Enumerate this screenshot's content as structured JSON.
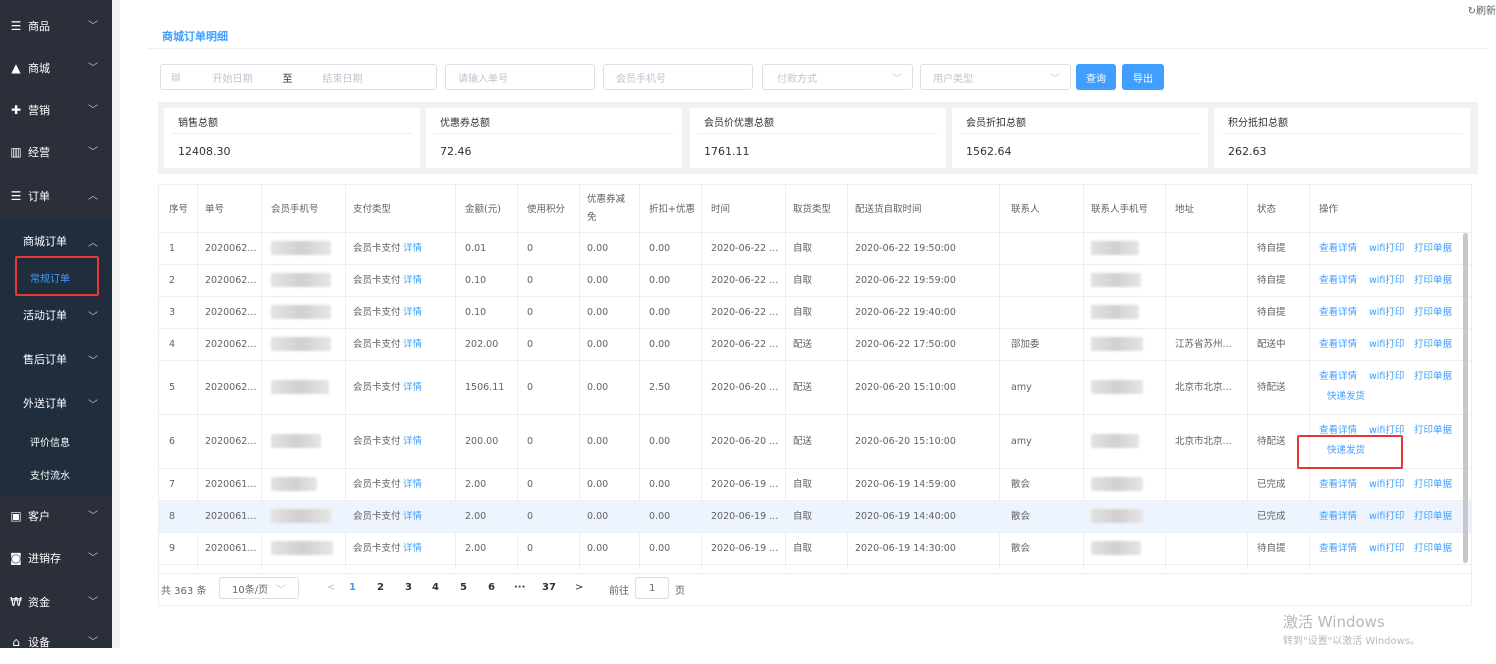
{
  "sidebar": {
    "items": [
      {
        "icon": "list-icon",
        "glyph": "☰",
        "label": "商品"
      },
      {
        "icon": "store-icon",
        "glyph": "▲",
        "label": "商城"
      },
      {
        "icon": "gift-icon",
        "glyph": "✚",
        "label": "营销"
      },
      {
        "icon": "chart-icon",
        "glyph": "▥",
        "label": "经营"
      },
      {
        "icon": "order-icon",
        "glyph": "☰",
        "label": "订单"
      },
      {
        "icon": "customer-icon",
        "glyph": "▣",
        "label": "客户"
      },
      {
        "icon": "truck-icon",
        "glyph": "◙",
        "label": "进销存"
      },
      {
        "icon": "money-icon",
        "glyph": "₩",
        "label": "资金"
      },
      {
        "icon": "device-icon",
        "glyph": "⌂",
        "label": "设备"
      }
    ],
    "sub": {
      "mall_order": "商城订单",
      "normal_order": "常规订单",
      "activity_order": "活动订单",
      "aftersale_order": "售后订单",
      "delivery_order": "外送订单",
      "review": "评价信息",
      "payment_flow": "支付流水"
    }
  },
  "header": {
    "title": "商城订单明细",
    "refresh": "刷新"
  },
  "filters": {
    "start_date": "开始日期",
    "to": "至",
    "end_date": "结束日期",
    "order_no_placeholder": "请输入单号",
    "phone_placeholder": "会员手机号",
    "pay_method_placeholder": "付款方式",
    "user_type_placeholder": "用户类型",
    "query": "查询",
    "export": "导出"
  },
  "summary": [
    {
      "label": "销售总额",
      "value": "12408.30"
    },
    {
      "label": "优惠券总额",
      "value": "72.46"
    },
    {
      "label": "会员价优惠总额",
      "value": "1761.11"
    },
    {
      "label": "会员折扣总额",
      "value": "1562.64"
    },
    {
      "label": "积分抵扣总额",
      "value": "262.63"
    }
  ],
  "table": {
    "headers": [
      "序号",
      "单号",
      "会员手机号",
      "支付类型",
      "金额(元)",
      "使用积分",
      "优惠券减",
      "免",
      "折扣+优惠",
      "时间",
      "取货类型",
      "配送货自取时间",
      "联系人",
      "联系人手机号",
      "地址",
      "状态",
      "操作"
    ],
    "action_labels": {
      "detail": "查看详情",
      "wifi": "wifi打印",
      "print": "打印单据",
      "express": "快递发货"
    },
    "rows": [
      {
        "seq": "1",
        "no": "2020062...",
        "pay": "会员卡支付",
        "detail": "详情",
        "amount": "0.01",
        "points": "0",
        "coupon": "0.00",
        "discount": "0.00",
        "time": "2020-06-22 ...",
        "pickup": "自取",
        "pick_time": "2020-06-22 19:50:00",
        "contact": "",
        "addr": "",
        "status": "待自提",
        "express": false
      },
      {
        "seq": "2",
        "no": "2020062...",
        "pay": "会员卡支付",
        "detail": "详情",
        "amount": "0.10",
        "points": "0",
        "coupon": "0.00",
        "discount": "0.00",
        "time": "2020-06-22 ...",
        "pickup": "自取",
        "pick_time": "2020-06-22 19:59:00",
        "contact": "",
        "addr": "",
        "status": "待自提",
        "express": false
      },
      {
        "seq": "3",
        "no": "2020062...",
        "pay": "会员卡支付",
        "detail": "详情",
        "amount": "0.10",
        "points": "0",
        "coupon": "0.00",
        "discount": "0.00",
        "time": "2020-06-22 ...",
        "pickup": "自取",
        "pick_time": "2020-06-22 19:40:00",
        "contact": "",
        "addr": "",
        "status": "待自提",
        "express": false
      },
      {
        "seq": "4",
        "no": "2020062...",
        "pay": "会员卡支付",
        "detail": "详情",
        "amount": "202.00",
        "points": "0",
        "coupon": "0.00",
        "discount": "0.00",
        "time": "2020-06-22 ...",
        "pickup": "配送",
        "pick_time": "2020-06-22 17:50:00",
        "contact": "邵加委",
        "addr": "江苏省苏州...",
        "status": "配送中",
        "express": false
      },
      {
        "seq": "5",
        "no": "2020062...",
        "pay": "会员卡支付",
        "detail": "详情",
        "amount": "1506.11",
        "points": "0",
        "coupon": "0.00",
        "discount": "2.50",
        "time": "2020-06-20 ...",
        "pickup": "配送",
        "pick_time": "2020-06-20 15:10:00",
        "contact": "amy",
        "addr": "北京市北京...",
        "status": "待配送",
        "express": true
      },
      {
        "seq": "6",
        "no": "2020062...",
        "pay": "会员卡支付",
        "detail": "详情",
        "amount": "200.00",
        "points": "0",
        "coupon": "0.00",
        "discount": "0.00",
        "time": "2020-06-20 ...",
        "pickup": "配送",
        "pick_time": "2020-06-20 15:10:00",
        "contact": "amy",
        "addr": "北京市北京...",
        "status": "待配送",
        "express": true
      },
      {
        "seq": "7",
        "no": "2020061...",
        "pay": "会员卡支付",
        "detail": "详情",
        "amount": "2.00",
        "points": "0",
        "coupon": "0.00",
        "discount": "0.00",
        "time": "2020-06-19 ...",
        "pickup": "自取",
        "pick_time": "2020-06-19 14:59:00",
        "contact": "散会",
        "addr": "",
        "status": "已完成",
        "express": false
      },
      {
        "seq": "8",
        "no": "2020061...",
        "pay": "会员卡支付",
        "detail": "详情",
        "amount": "2.00",
        "points": "0",
        "coupon": "0.00",
        "discount": "0.00",
        "time": "2020-06-19 ...",
        "pickup": "自取",
        "pick_time": "2020-06-19 14:40:00",
        "contact": "散会",
        "addr": "",
        "status": "已完成",
        "express": false
      },
      {
        "seq": "9",
        "no": "2020061...",
        "pay": "会员卡支付",
        "detail": "详情",
        "amount": "2.00",
        "points": "0",
        "coupon": "0.00",
        "discount": "0.00",
        "time": "2020-06-19 ...",
        "pickup": "自取",
        "pick_time": "2020-06-19 14:30:00",
        "contact": "散会",
        "addr": "",
        "status": "待自提",
        "express": false
      }
    ]
  },
  "pagination": {
    "total": "共 363 条",
    "page_size": "10条/页",
    "prev": "<",
    "pages": [
      "1",
      "2",
      "3",
      "4",
      "5",
      "6",
      "···",
      "37"
    ],
    "next": ">",
    "goto": "前往",
    "goto_value": "1",
    "page_unit": "页"
  },
  "watermark": {
    "line1": "激活 Windows",
    "line2": "转到\"设置\"以激活 Windows。"
  }
}
